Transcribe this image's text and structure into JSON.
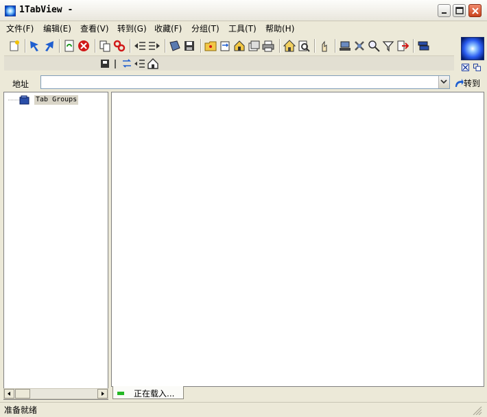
{
  "window": {
    "title": "1TabView -",
    "icon": "app-logo-icon"
  },
  "titlebar_buttons": [
    "minimize-icon",
    "maximize-icon",
    "close-icon"
  ],
  "menu": [
    {
      "label": "文件(F)"
    },
    {
      "label": "编辑(E)"
    },
    {
      "label": "查看(V)"
    },
    {
      "label": "转到(G)"
    },
    {
      "label": "收藏(F)"
    },
    {
      "label": "分组(T)"
    },
    {
      "label": "工具(T)"
    },
    {
      "label": "帮助(H)"
    }
  ],
  "toolbar": {
    "row1_icons": [
      "new-tab-icon",
      "back-arrow-icon",
      "forward-arrow-icon",
      "refresh-icon",
      "stop-icon",
      "copy-tab-icon",
      "link-icon",
      "tree-left-icon",
      "tree-right-icon",
      "book-icon",
      "save-icon",
      "folder-icon",
      "transfer-icon",
      "home-folder-icon",
      "tabs-icon",
      "print-icon",
      "home-icon",
      "search-page-icon",
      "hand-icon",
      "network-icon",
      "tools-icon",
      "search-icon",
      "filter-icon",
      "exit-icon",
      "windows-icon"
    ],
    "row2_icons": [
      "group-save-icon",
      "divider-icon",
      "refresh-list-icon",
      "outdent-icon",
      "home-small-icon"
    ]
  },
  "address": {
    "label": "地址",
    "value": "",
    "go_label": "转到"
  },
  "tree": {
    "root_label": "Tab Groups"
  },
  "tabs": [
    {
      "label": "正在载入...",
      "status_color": "#25b825"
    }
  ],
  "status": {
    "text": "准备就绪"
  },
  "colors": {
    "accent": "#0047c7",
    "close_button": "#c9421c",
    "stop_red": "#d01818"
  }
}
